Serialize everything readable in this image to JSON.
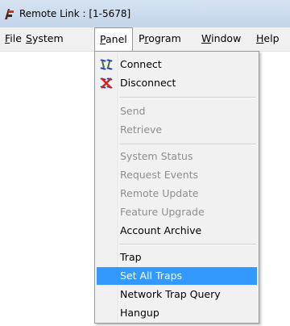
{
  "window": {
    "title": "Remote Link : [1-5678]"
  },
  "menubar": {
    "items": [
      {
        "u": "F",
        "rest": "ile"
      },
      {
        "u": "S",
        "rest": "ystem"
      },
      {
        "u": "P",
        "rest": "anel"
      },
      {
        "pre": "P",
        "u": "r",
        "rest": "ogram"
      },
      {
        "u": "W",
        "rest": "indow"
      },
      {
        "u": "H",
        "rest": "elp"
      }
    ],
    "active": "Panel"
  },
  "panel_menu": {
    "items": [
      {
        "label": "Connect",
        "icon": "connect-icon",
        "enabled": true
      },
      {
        "label": "Disconnect",
        "icon": "disconnect-icon",
        "enabled": true
      },
      {
        "label": "Send",
        "enabled": false
      },
      {
        "label": "Retrieve",
        "enabled": false
      },
      {
        "label": "System Status",
        "enabled": false
      },
      {
        "label": "Request Events",
        "enabled": false
      },
      {
        "label": "Remote Update",
        "enabled": false
      },
      {
        "label": "Feature Upgrade",
        "enabled": false
      },
      {
        "label": "Account Archive",
        "enabled": true
      },
      {
        "label": "Trap",
        "enabled": true
      },
      {
        "label": "Set All Traps",
        "enabled": true,
        "highlighted": true
      },
      {
        "label": "Network Trap Query",
        "enabled": true
      },
      {
        "label": "Hangup",
        "enabled": true
      }
    ]
  },
  "colors": {
    "highlight": "#3399ff",
    "disabled_text": "#8e8e8e",
    "menu_bg": "#f1f1f1"
  }
}
